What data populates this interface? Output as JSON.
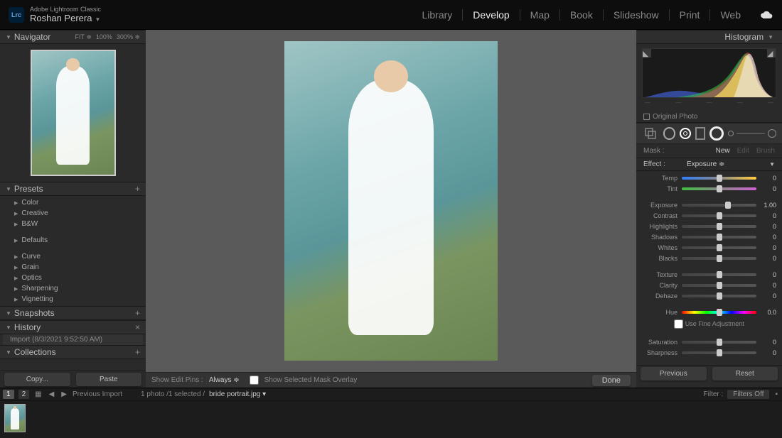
{
  "header": {
    "app_name": "Adobe Lightroom Classic",
    "logo_text": "Lrc",
    "user_name": "Roshan Perera",
    "modules": [
      "Library",
      "Develop",
      "Map",
      "Book",
      "Slideshow",
      "Print",
      "Web"
    ],
    "active_module": "Develop"
  },
  "left": {
    "navigator": {
      "title": "Navigator",
      "zoom": [
        "FIT",
        "100%",
        "300%"
      ]
    },
    "presets": {
      "title": "Presets",
      "items": [
        "Color",
        "Creative",
        "B&W",
        "Defaults",
        "Curve",
        "Grain",
        "Optics",
        "Sharpening",
        "Vignetting"
      ]
    },
    "snapshots": {
      "title": "Snapshots"
    },
    "history": {
      "title": "History",
      "entry": "Import (8/3/2021 9:52:50 AM)"
    },
    "collections": {
      "title": "Collections"
    },
    "actions": {
      "copy": "Copy...",
      "paste": "Paste"
    }
  },
  "center": {
    "bar": {
      "show_edit_pins": "Show Edit Pins :",
      "always": "Always",
      "show_overlay": "Show Selected Mask Overlay",
      "done": "Done"
    }
  },
  "right": {
    "histogram": {
      "title": "Histogram"
    },
    "original_photo": "Original Photo",
    "mask": {
      "label": "Mask :",
      "new": "New",
      "edit": "Edit",
      "brush": "Brush"
    },
    "effect": {
      "label": "Effect :",
      "selected": "Exposure"
    },
    "sliders": {
      "group1": [
        {
          "name": "Temp",
          "value": "0",
          "track": "temp"
        },
        {
          "name": "Tint",
          "value": "0",
          "track": "tint"
        }
      ],
      "group2": [
        {
          "name": "Exposure",
          "value": "1.00",
          "pos": "62"
        },
        {
          "name": "Contrast",
          "value": "0"
        },
        {
          "name": "Highlights",
          "value": "0"
        },
        {
          "name": "Shadows",
          "value": "0"
        },
        {
          "name": "Whites",
          "value": "0"
        },
        {
          "name": "Blacks",
          "value": "0"
        }
      ],
      "group3": [
        {
          "name": "Texture",
          "value": "0"
        },
        {
          "name": "Clarity",
          "value": "0"
        },
        {
          "name": "Dehaze",
          "value": "0"
        }
      ],
      "hue": {
        "name": "Hue",
        "value": "0.0",
        "track": "hue"
      },
      "fine_adjust": "Use Fine Adjustment",
      "group4": [
        {
          "name": "Saturation",
          "value": "0"
        },
        {
          "name": "Sharpness",
          "value": "0"
        }
      ]
    },
    "actions": {
      "previous": "Previous",
      "reset": "Reset"
    }
  },
  "footer": {
    "survey1": "1",
    "survey2": "2",
    "previous_import": "Previous Import",
    "count": "1 photo  /1 selected  /",
    "filename": "bride portrait.jpg",
    "filter_label": "Filter :",
    "filter_value": "Filters Off"
  }
}
